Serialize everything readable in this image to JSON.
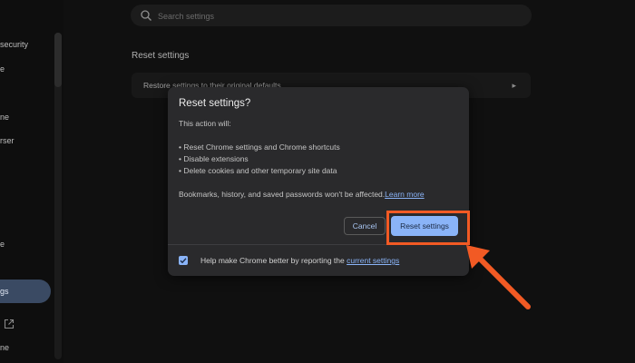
{
  "sidebar": {
    "items": [
      {
        "label": "security"
      },
      {
        "label": "e"
      },
      {
        "label": "ne"
      },
      {
        "label": "rser"
      },
      {
        "label": "e"
      },
      {
        "label": "ne"
      }
    ],
    "active_label": "gs"
  },
  "search": {
    "placeholder": "Search settings"
  },
  "main": {
    "section_title": "Reset settings",
    "restore_label": "Restore settings to their original defaults"
  },
  "dialog": {
    "title": "Reset settings?",
    "intro": "This action will:",
    "bullets": [
      "• Reset Chrome settings and Chrome shortcuts",
      "• Disable extensions",
      "• Delete cookies and other temporary site data"
    ],
    "note": "Bookmarks, history, and saved passwords won't be affected.",
    "learn_more": "Learn more",
    "cancel_label": "Cancel",
    "reset_label": "Reset settings",
    "report_text": "Help make Chrome better by reporting the ",
    "report_link": "current settings",
    "report_checked": true
  },
  "annotation": {
    "color": "#f25a24"
  },
  "colors": {
    "accent": "#8ab4f8",
    "dialog_bg": "#2a2a2c",
    "page_bg": "#101010"
  }
}
